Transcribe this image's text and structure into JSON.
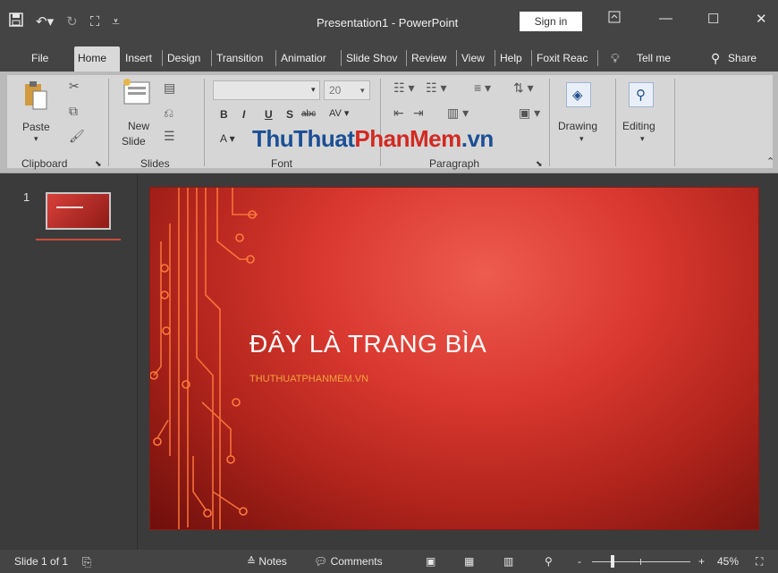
{
  "titlebar": {
    "title": "Presentation1  -  PowerPoint",
    "sign_in": "Sign in",
    "qat_icons": [
      "save-icon",
      "undo-icon",
      "redo-icon",
      "start-from-beginning-icon",
      "customize-qat-icon"
    ],
    "window_controls": [
      "ribbon-display-options-icon",
      "minimize-icon",
      "maximize-icon",
      "close-icon"
    ]
  },
  "tabs": [
    {
      "label": "File"
    },
    {
      "label": "Home",
      "active": true
    },
    {
      "label": "Insert"
    },
    {
      "label": "Design"
    },
    {
      "label": "Transition"
    },
    {
      "label": "Animatior"
    },
    {
      "label": "Slide Shov"
    },
    {
      "label": "Review"
    },
    {
      "label": "View"
    },
    {
      "label": "Help"
    },
    {
      "label": "Foxit Reac"
    },
    {
      "label": "Tell me"
    },
    {
      "label": "Share"
    }
  ],
  "ribbon": {
    "clipboard": {
      "paste": "Paste",
      "group": "Clipboard"
    },
    "slides": {
      "new_slide_1": "New",
      "new_slide_2": "Slide",
      "group": "Slides"
    },
    "font": {
      "size": "20",
      "group": "Font"
    },
    "paragraph": {
      "group": "Paragraph"
    },
    "drawing": {
      "label": "Drawing"
    },
    "editing": {
      "label": "Editing"
    }
  },
  "watermark": {
    "part1": "ThuThuat",
    "part2": "PhanMem",
    "part3": ".vn",
    "color_dark": "#1b4f95",
    "color_red": "#d12a21"
  },
  "thumbnails": [
    {
      "number": "1"
    }
  ],
  "slide": {
    "title": "ĐÂY LÀ TRANG BÌA",
    "subtitle": "THUTHUATPHANMEM.VN",
    "accent": "#f3a23c"
  },
  "statusbar": {
    "slide_info": "Slide 1 of 1",
    "notes": "Notes",
    "comments": "Comments",
    "zoom": "45%",
    "zoom_minus": "-",
    "zoom_plus": "+"
  }
}
